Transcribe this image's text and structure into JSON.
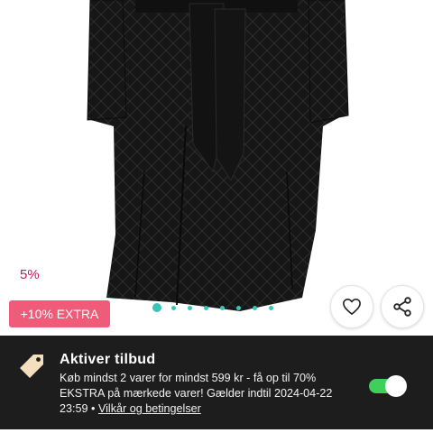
{
  "product": {
    "discount_label": "5%",
    "extra_badge": "+10% EXTRA",
    "carousel": {
      "total": 8,
      "active_index": 0
    }
  },
  "offer": {
    "title": "Aktiver tilbud",
    "description": "Køb mindst 2 varer for mindst 599 kr - få op til 70% EKSTRA på mærkede varer! Gælder indtil 2024-04-22 23:59 • ",
    "terms_link": "Vilkår og betingelser",
    "toggle_on": true
  },
  "colors": {
    "accent": "#39c4b9",
    "badge": "#ef5b78",
    "discount": "#c2185b",
    "banner_bg": "#1d1d1d",
    "toggle": "#3fcf5b"
  },
  "icons": {
    "favorite": "heart-icon",
    "share": "share-icon",
    "offer": "price-tag-icon"
  }
}
